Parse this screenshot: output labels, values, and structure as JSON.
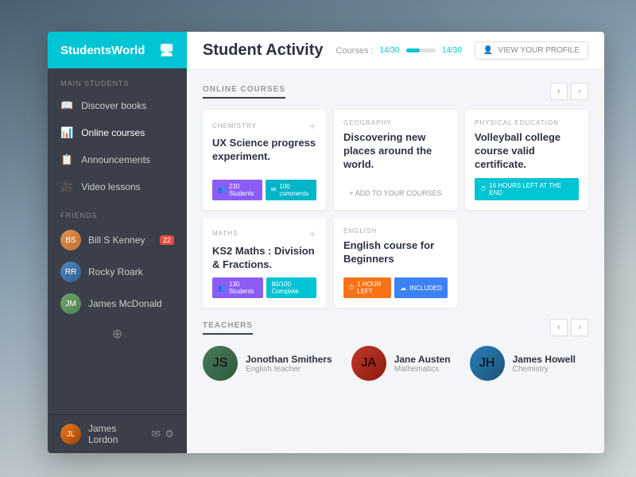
{
  "app": {
    "name": "StudentsWorld",
    "logo_icon": "🖥"
  },
  "sidebar": {
    "section_main": "MAIN STUDENTS",
    "nav_items": [
      {
        "id": "discover",
        "label": "Discover books",
        "icon": "📖"
      },
      {
        "id": "online",
        "label": "Online courses",
        "icon": "📊",
        "active": true
      },
      {
        "id": "announcements",
        "label": "Announcements",
        "icon": "📋"
      },
      {
        "id": "video",
        "label": "Video lessons",
        "icon": "🎥"
      }
    ],
    "section_friends": "FRIENDS",
    "friends": [
      {
        "name": "Bill S Kenney",
        "badge": "22",
        "color": "friend1"
      },
      {
        "name": "Rocky Roark",
        "color": "friend2"
      },
      {
        "name": "James McDonald",
        "color": "friend3"
      }
    ],
    "footer_user": "James Lordon"
  },
  "header": {
    "title": "Student Activity",
    "courses_label": "Courses :",
    "progress_current": 14,
    "progress_total": 30,
    "progress_pct": 47,
    "progress_text": "14/30",
    "view_profile": "VIEW YOUR PROFILE"
  },
  "online_courses": {
    "section_title": "ONLINE COURSES",
    "cards": [
      {
        "category": "CHEMISTRY",
        "title": "UX Science progress experiment.",
        "has_add": true,
        "stats": [
          {
            "label": "230 Students",
            "icon": "👥",
            "type": "purple"
          },
          {
            "label": "100 comments",
            "icon": "✉",
            "type": "teal"
          }
        ]
      },
      {
        "category": "GEOGRAPHY",
        "title": "Discovering new places around the world.",
        "has_add": false,
        "action": "+ ADD TO YOUR COURSES"
      },
      {
        "category": "PHYSICAL EDUCATION",
        "title": "Volleyball college course valid certificate.",
        "has_add": false,
        "time_badge": "16 HOURS LEFT AT THE END"
      },
      {
        "category": "MATHS",
        "title": "KS2 Maths : Division & Fractions.",
        "has_add": true,
        "stats": [
          {
            "label": "130 Students",
            "icon": "👥",
            "type": "purple"
          },
          {
            "label": "80/100 Complete",
            "icon": "",
            "type": "progress"
          }
        ]
      },
      {
        "category": "ENGLISH",
        "title": "English course for Beginners",
        "has_add": false,
        "bottom_badges": [
          {
            "label": "1 HOUR LEFT",
            "icon": "⏱",
            "type": "orange"
          },
          {
            "label": "INCLUDED",
            "icon": "☁",
            "type": "blue"
          }
        ]
      }
    ]
  },
  "teachers": {
    "section_title": "TEACHERS",
    "list": [
      {
        "name": "Jonothan Smithers",
        "role": "English teacher",
        "color": "av-green"
      },
      {
        "name": "Jane Austen",
        "role": "Mathematics",
        "color": "av-red"
      },
      {
        "name": "James Howell",
        "role": "Chemistry",
        "color": "av-blue"
      }
    ]
  }
}
